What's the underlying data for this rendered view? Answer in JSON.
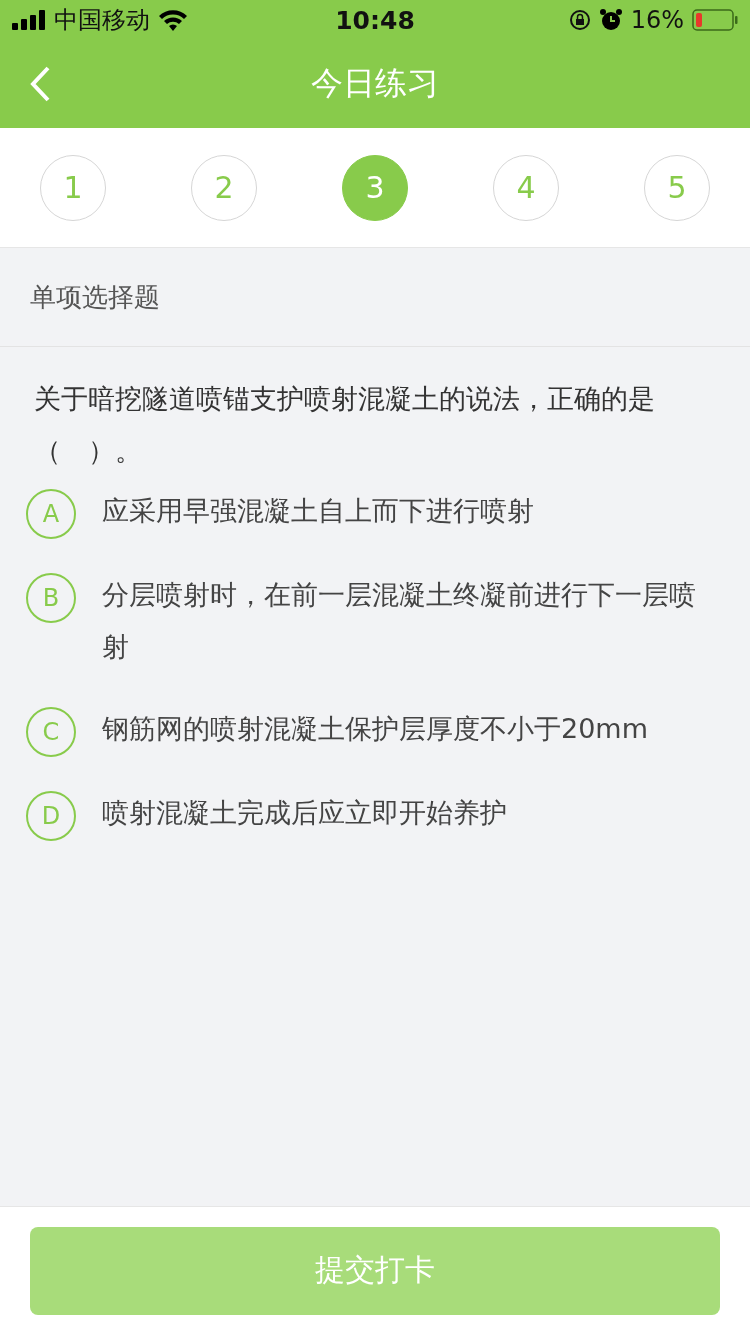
{
  "status_bar": {
    "carrier": "中国移动",
    "time": "10:48",
    "battery": "16%"
  },
  "nav": {
    "title": "今日练习"
  },
  "steps": [
    {
      "label": "1",
      "selected": false
    },
    {
      "label": "2",
      "selected": false
    },
    {
      "label": "3",
      "selected": true
    },
    {
      "label": "4",
      "selected": false
    },
    {
      "label": "5",
      "selected": false
    }
  ],
  "section": "单项选择题",
  "question": "关于暗挖隧道喷锚支护喷射混凝土的说法，正确的是（　）。",
  "options": [
    {
      "letter": "A",
      "text": "应采用早强混凝土自上而下进行喷射",
      "selected": false
    },
    {
      "letter": "B",
      "text": "分层喷射时，在前一层混凝土终凝前进行下一层喷射",
      "selected": false
    },
    {
      "letter": "C",
      "text": "钢筋网的喷射混凝土保护层厚度不小于20mm",
      "selected": false
    },
    {
      "letter": "D",
      "text": "喷射混凝土完成后应立即开始养护",
      "selected": false
    }
  ],
  "submit": {
    "label": "提交打卡",
    "disabled": true
  }
}
